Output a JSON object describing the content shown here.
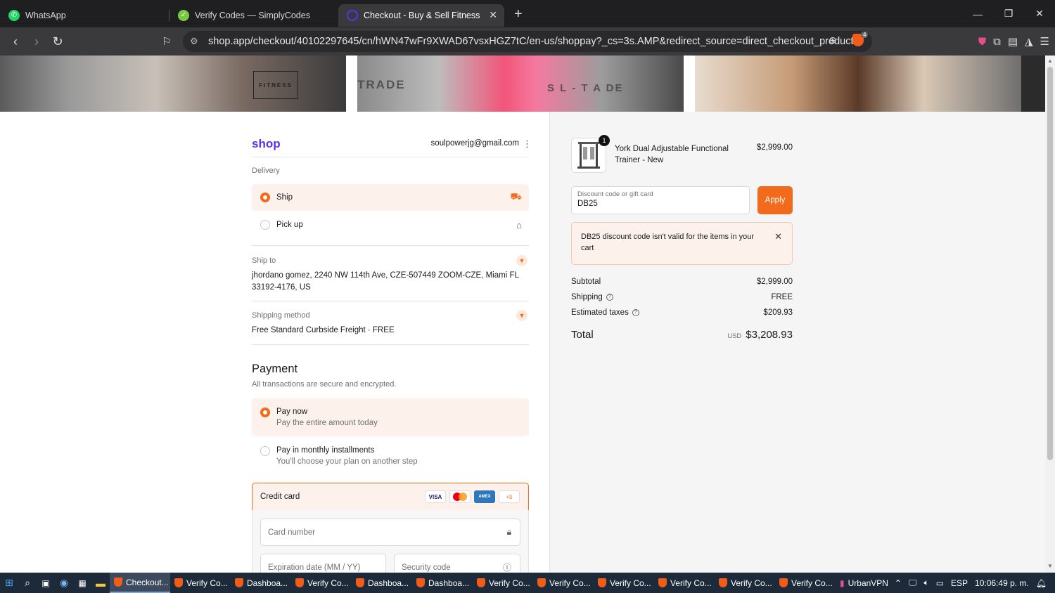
{
  "browser": {
    "tabs": [
      {
        "label": "WhatsApp",
        "icon": "whatsapp-icon",
        "color": "#25d366"
      },
      {
        "label": "Verify Codes — SimplyCodes",
        "icon": "simplycodes-icon",
        "color": "#7ac943"
      },
      {
        "label": "Checkout - Buy & Sell Fitness",
        "icon": "shop-icon",
        "color": "#5a31f4"
      }
    ],
    "new_tab": "+",
    "url": "shop.app/checkout/40102297645/cn/hWN47wFr9XWAD67vsxHGZ7tC/en-us/shoppay?_cs=3s.AMP&redirect_source=direct_checkout_product...",
    "extension_badge": "4"
  },
  "banner": {
    "logo": "FITNESS",
    "texts": [
      "TRADE",
      "S  L  -  T  A  DE"
    ]
  },
  "checkout": {
    "shop_logo": "shop",
    "email": "soulpowerjg@gmail.com",
    "delivery_label": "Delivery",
    "delivery_options": [
      {
        "label": "Ship",
        "selected": true
      },
      {
        "label": "Pick up",
        "selected": false
      }
    ],
    "ship_to_label": "Ship to",
    "address_line1": "jhordano gomez, 2240 NW 114th Ave, CZE-507449 ZOOM-CZE, Miami FL",
    "address_line2": "33192-4176, US",
    "shipping_method_label": "Shipping method",
    "shipping_method_value": "Free Standard Curbside Freight · FREE",
    "payment_title": "Payment",
    "payment_subtitle": "All transactions are secure and encrypted.",
    "payment_options": [
      {
        "title": "Pay now",
        "sub": "Pay the entire amount today",
        "selected": true
      },
      {
        "title": "Pay in monthly installments",
        "sub": "You'll choose your plan on another step",
        "selected": false
      }
    ],
    "credit_card_label": "Credit card",
    "card_brands": [
      "VISA",
      "",
      "AMEX",
      "+5"
    ],
    "card_number_placeholder": "Card number",
    "expiration_placeholder": "Expiration date (MM / YY)",
    "security_placeholder": "Security code"
  },
  "summary": {
    "qty": "1",
    "product_name": "York Dual Adjustable Functional Trainer - New",
    "product_price": "$2,999.00",
    "discount_label": "Discount code or gift card",
    "discount_value": "DB25",
    "apply_label": "Apply",
    "alert_text": "DB25 discount code isn't valid for the items in your cart",
    "subtotal_label": "Subtotal",
    "subtotal_value": "$2,999.00",
    "shipping_label": "Shipping",
    "shipping_value": "FREE",
    "taxes_label": "Estimated taxes",
    "taxes_value": "$209.93",
    "total_label": "Total",
    "currency": "USD",
    "total_value": "$3,208.93"
  },
  "taskbar": {
    "apps": [
      "Checkout...",
      "Verify Co...",
      "Dashboa...",
      "Verify Co...",
      "Dashboa...",
      "Dashboa...",
      "Verify Co...",
      "Verify Co...",
      "Verify Co...",
      "Verify Co...",
      "Verify Co...",
      "Verify Co..."
    ],
    "vpn": "UrbanVPN",
    "lang": "ESP",
    "time": "10:06:49 p. m."
  },
  "colors": {
    "accent": "#f26a1b",
    "shop_brand": "#5a31f4"
  }
}
